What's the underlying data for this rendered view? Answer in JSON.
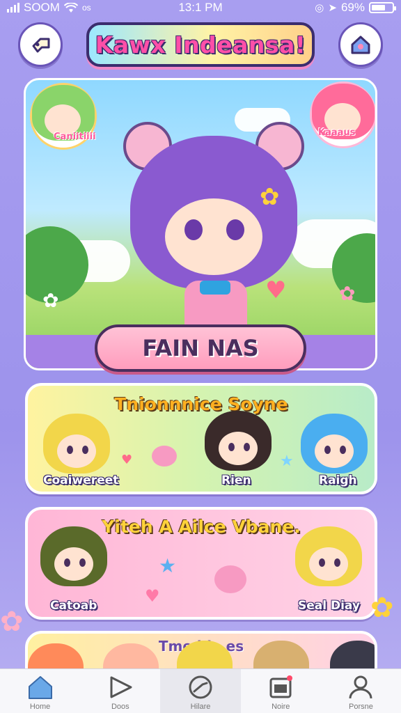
{
  "status_bar": {
    "carrier": "SOOM",
    "extra": "os",
    "time": "13:1 PM",
    "battery": "69%",
    "battery_level": 0.69
  },
  "header": {
    "title": "Kawx Indeansa!",
    "back_icon": "back-arrow-icon",
    "home_icon": "home-icon"
  },
  "hero": {
    "sticker_left_label": "Caniitiiii",
    "sticker_right_label": "Kaaaus",
    "action_label": "FAIN NAS"
  },
  "groups": [
    {
      "title": "Tnionnnice Soyne",
      "characters": [
        {
          "label": "Coaiwereet",
          "hair": "#f2d64a"
        },
        {
          "label": "Rien",
          "hair": "#3a2a2a"
        },
        {
          "label": "Raigh",
          "hair": "#4aaef0"
        }
      ]
    },
    {
      "title": "Yiteh A Ailce Vbane.",
      "characters": [
        {
          "label": "Catoab",
          "hair": "#5a6a2a"
        },
        {
          "label": "Seal Diay",
          "hair": "#f2d64a"
        }
      ]
    },
    {
      "title": "Tme  hio  es"
    }
  ],
  "bottom_nav": [
    {
      "label": "Home",
      "icon": "home-icon"
    },
    {
      "label": "Doos",
      "icon": "play-icon"
    },
    {
      "label": "Hilare",
      "icon": "compass-icon",
      "active": true
    },
    {
      "label": "Noire",
      "icon": "calendar-icon"
    },
    {
      "label": "Porsne",
      "icon": "profile-icon"
    }
  ],
  "colors": {
    "background": "#a89ef0",
    "accent_pink": "#ff9dbd",
    "accent_purple": "#8a5ad0",
    "outline": "#3b2d6e"
  }
}
